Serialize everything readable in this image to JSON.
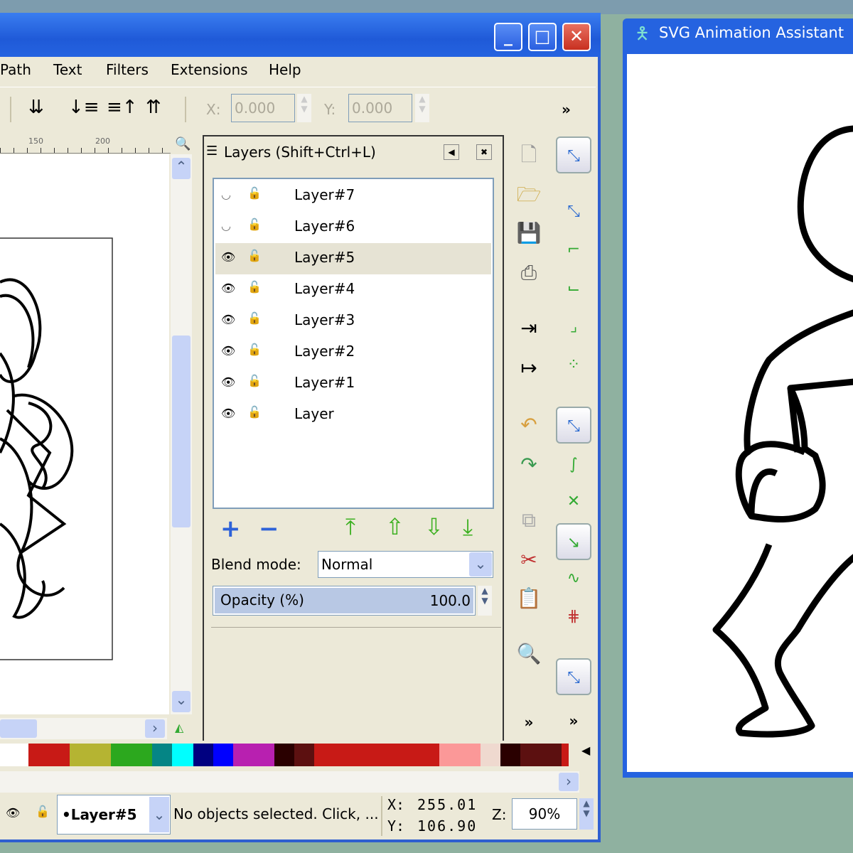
{
  "main_window": {
    "title_buttons": {
      "minimize": "_",
      "maximize": "□",
      "close": "✕"
    },
    "menu": [
      "Path",
      "Text",
      "Filters",
      "Extensions",
      "Help"
    ],
    "toolbar": {
      "x_label": "X:",
      "x_value": "0.000",
      "y_label": "Y:",
      "y_value": "0.000",
      "overflow": "»"
    },
    "ruler": [
      "150",
      "200"
    ],
    "layers_panel": {
      "title": "Layers (Shift+Ctrl+L)",
      "layers": [
        {
          "name": "Layer#7",
          "visible": false,
          "selected": false
        },
        {
          "name": "Layer#6",
          "visible": false,
          "selected": false
        },
        {
          "name": "Layer#5",
          "visible": true,
          "selected": true
        },
        {
          "name": "Layer#4",
          "visible": true,
          "selected": false
        },
        {
          "name": "Layer#3",
          "visible": true,
          "selected": false
        },
        {
          "name": "Layer#2",
          "visible": true,
          "selected": false
        },
        {
          "name": "Layer#1",
          "visible": true,
          "selected": false
        },
        {
          "name": "Layer",
          "visible": true,
          "selected": false
        }
      ],
      "blend_label": "Blend mode:",
      "blend_value": "Normal",
      "opacity_label": "Opacity (%)",
      "opacity_value": "100.0"
    },
    "commands_overflow": "»",
    "snap_overflow": "»",
    "palette": [
      "#ffffff",
      "#c81a16",
      "#b5b432",
      "#2ca81e",
      "#058585",
      "#00ffff",
      "#000080",
      "#0000ff",
      "#b820b0",
      "#2a0000",
      "#5c1010",
      "#c81a16",
      "#c81a16",
      "#fb9898",
      "#efd9cf",
      "#2a0000",
      "#5c1010",
      "#c81a16"
    ],
    "status": {
      "current_layer": "•Layer#5",
      "message": "No objects selected. Click, ...",
      "x_label": "X:",
      "x_value": "255.01",
      "y_label": "Y:",
      "y_value": "106.90",
      "zoom_label": "Z:",
      "zoom_value": "90%"
    }
  },
  "assistant_window": {
    "title": "SVG Animation Assistant"
  }
}
